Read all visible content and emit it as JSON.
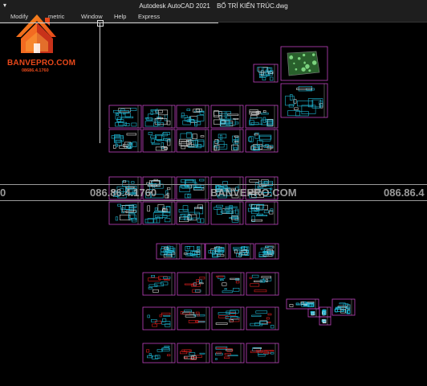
{
  "titlebar": {
    "app_name": "Autodesk AutoCAD 2021",
    "file_name": "BỐ TRÍ KIẾN TRÚC.dwg",
    "quick_access_icon": "dropdown-arrow-icon"
  },
  "menubar": {
    "items": [
      "Modify",
      "Parametric",
      "Window",
      "Help",
      "Express"
    ],
    "visible_labels": [
      "Modify",
      "metric",
      "Window",
      "Help",
      "Express"
    ]
  },
  "logo": {
    "brand": "BANVEPRO.COM",
    "phone": "08686.4.1760",
    "icon": "house-logo-icon"
  },
  "watermark": {
    "left_text": "0",
    "center_phone": "086.86.4.1760",
    "center_site": "BANVEPRO.COM",
    "right_text": "086.86.4"
  },
  "colors": {
    "background": "#000000",
    "sheet_border": "#c040c0",
    "drawing_lines": "#1fb8d6",
    "brand": "#e8481a",
    "accent_red": "#e02020",
    "site_plan_green": "#4caf50"
  }
}
